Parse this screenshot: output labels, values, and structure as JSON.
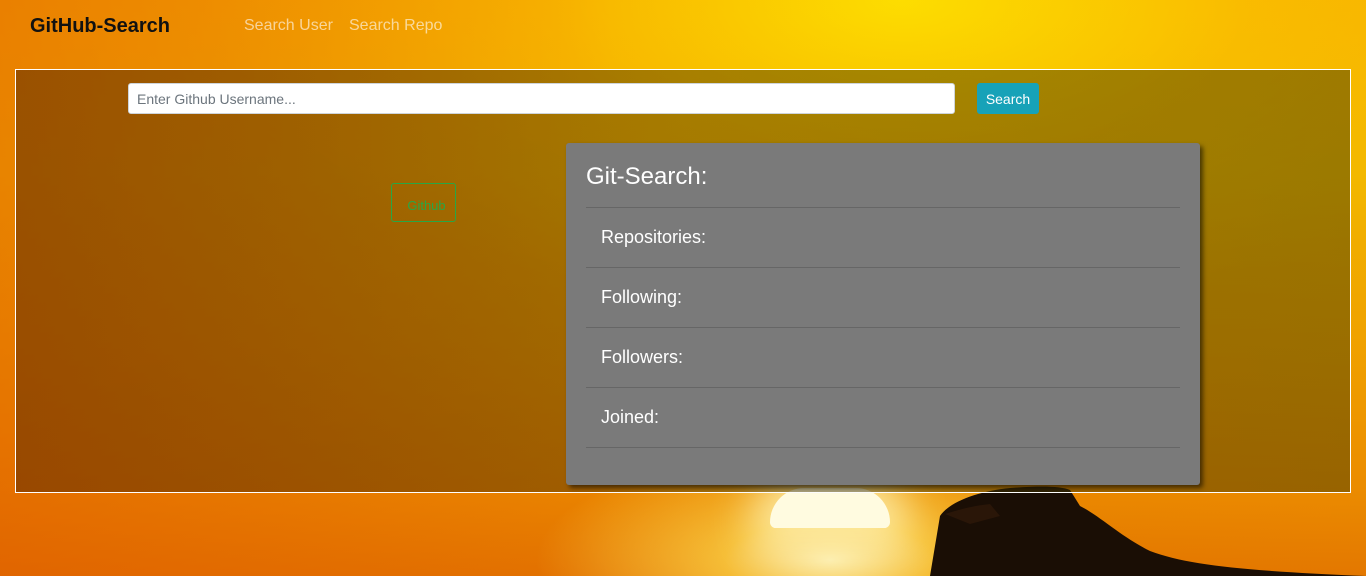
{
  "nav": {
    "brand": "GitHub-Search",
    "links": [
      {
        "label": "Search User"
      },
      {
        "label": "Search Repo"
      }
    ]
  },
  "search": {
    "placeholder": "Enter Github Username...",
    "value": "",
    "button_label": "Search"
  },
  "profile": {
    "github_button_label": "Github"
  },
  "card": {
    "title": "Git-Search:",
    "items": [
      {
        "label": "Repositories:"
      },
      {
        "label": "Following:"
      },
      {
        "label": "Followers:"
      },
      {
        "label": "Joined:"
      }
    ]
  },
  "colors": {
    "accent_info": "#17a2b8",
    "accent_success": "#28a745",
    "card_bg": "#7a7a7a",
    "background_sky": "#f5a800"
  }
}
